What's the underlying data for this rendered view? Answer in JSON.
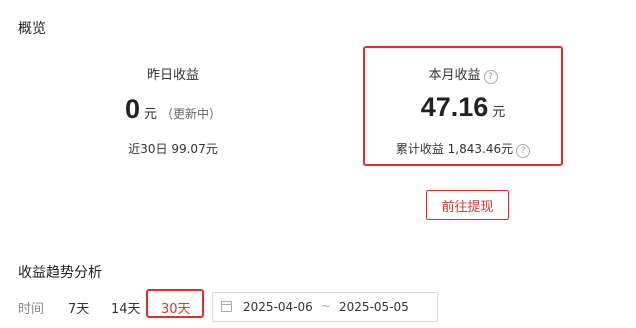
{
  "overview": {
    "title": "概览",
    "yesterday": {
      "label": "昨日收益",
      "value": "0",
      "unit": "元",
      "status": "（更新中）",
      "sub": "近30日 99.07元"
    },
    "month": {
      "label": "本月收益",
      "value": "47.16",
      "unit": "元",
      "sub": "累计收益 1,843.46元",
      "help_icon": "question-circle-icon"
    },
    "withdraw_button": "前往提现"
  },
  "trend": {
    "title": "收益趋势分析",
    "time_label": "时间",
    "ranges": [
      "7天",
      "14天",
      "30天"
    ],
    "selected_range": "30天",
    "date_start": "2025-04-06",
    "date_separator": "~",
    "date_end": "2025-05-05",
    "calendar_icon": "calendar-icon"
  },
  "colors": {
    "accent": "#d13b32",
    "highlight_border": "#e0302a"
  }
}
